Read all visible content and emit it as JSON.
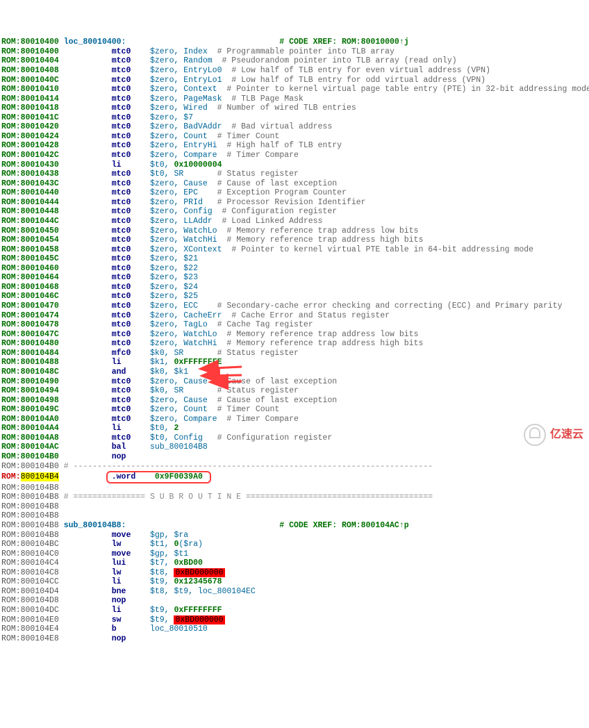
{
  "listing": [
    {
      "addr": "ROM:80010400",
      "style": "green",
      "loc": "loc_80010400:",
      "op": "",
      "args": "",
      "comment": "# CODE XREF: ROM:80010000↑j",
      "xref": true
    },
    {
      "addr": "ROM:80010400",
      "style": "green",
      "op": "mtc0",
      "reg": "$zero, Index",
      "comment": "# Programmable pointer into TLB array"
    },
    {
      "addr": "ROM:80010404",
      "style": "green",
      "op": "mtc0",
      "reg": "$zero, Random",
      "comment": "# Pseudorandom pointer into TLB array (read only)"
    },
    {
      "addr": "ROM:80010408",
      "style": "green",
      "op": "mtc0",
      "reg": "$zero, EntryLo0",
      "comment": "# Low half of TLB entry for even virtual address (VPN)"
    },
    {
      "addr": "ROM:8001040C",
      "style": "green",
      "op": "mtc0",
      "reg": "$zero, EntryLo1",
      "comment": "# Low half of TLB entry for odd virtual address (VPN)"
    },
    {
      "addr": "ROM:80010410",
      "style": "green",
      "op": "mtc0",
      "reg": "$zero, Context",
      "comment": "# Pointer to kernel virtual page table entry (PTE) in 32-bit addressing mode"
    },
    {
      "addr": "ROM:80010414",
      "style": "green",
      "op": "mtc0",
      "reg": "$zero, PageMask",
      "comment": "# TLB Page Mask"
    },
    {
      "addr": "ROM:80010418",
      "style": "green",
      "op": "mtc0",
      "reg": "$zero, Wired",
      "comment": "# Number of wired TLB entries"
    },
    {
      "addr": "ROM:8001041C",
      "style": "green",
      "op": "mtc0",
      "reg": "$zero, $7"
    },
    {
      "addr": "ROM:80010420",
      "style": "green",
      "op": "mtc0",
      "reg": "$zero, BadVAddr",
      "comment": "# Bad virtual address"
    },
    {
      "addr": "ROM:80010424",
      "style": "green",
      "op": "mtc0",
      "reg": "$zero, Count",
      "comment": "# Timer Count"
    },
    {
      "addr": "ROM:80010428",
      "style": "green",
      "op": "mtc0",
      "reg": "$zero, EntryHi",
      "comment": "# High half of TLB entry"
    },
    {
      "addr": "ROM:8001042C",
      "style": "green",
      "op": "mtc0",
      "reg": "$zero, Compare",
      "comment": "# Timer Compare"
    },
    {
      "addr": "ROM:80010430",
      "style": "green",
      "op": "li",
      "reg": "$t0,",
      "num": "0x10000004"
    },
    {
      "addr": "ROM:80010438",
      "style": "green",
      "op": "mtc0",
      "reg": "$t0, SR",
      "comment": "# Status register"
    },
    {
      "addr": "ROM:8001043C",
      "style": "green",
      "op": "mtc0",
      "reg": "$zero, Cause",
      "comment": "# Cause of last exception"
    },
    {
      "addr": "ROM:80010440",
      "style": "green",
      "op": "mtc0",
      "reg": "$zero, EPC",
      "comment": "# Exception Program Counter"
    },
    {
      "addr": "ROM:80010444",
      "style": "green",
      "op": "mtc0",
      "reg": "$zero, PRId",
      "comment": "# Processor Revision Identifier"
    },
    {
      "addr": "ROM:80010448",
      "style": "green",
      "op": "mtc0",
      "reg": "$zero, Config",
      "comment": "# Configuration register"
    },
    {
      "addr": "ROM:8001044C",
      "style": "green",
      "op": "mtc0",
      "reg": "$zero, LLAddr",
      "comment": "# Load Linked Address"
    },
    {
      "addr": "ROM:80010450",
      "style": "green",
      "op": "mtc0",
      "reg": "$zero, WatchLo",
      "comment": "# Memory reference trap address low bits"
    },
    {
      "addr": "ROM:80010454",
      "style": "green",
      "op": "mtc0",
      "reg": "$zero, WatchHi",
      "comment": "# Memory reference trap address high bits"
    },
    {
      "addr": "ROM:80010458",
      "style": "green",
      "op": "mtc0",
      "reg": "$zero, XContext",
      "comment": "# Pointer to kernel virtual PTE table in 64-bit addressing mode"
    },
    {
      "addr": "ROM:8001045C",
      "style": "green",
      "op": "mtc0",
      "reg": "$zero, $21"
    },
    {
      "addr": "ROM:80010460",
      "style": "green",
      "op": "mtc0",
      "reg": "$zero, $22"
    },
    {
      "addr": "ROM:80010464",
      "style": "green",
      "op": "mtc0",
      "reg": "$zero, $23"
    },
    {
      "addr": "ROM:80010468",
      "style": "green",
      "op": "mtc0",
      "reg": "$zero, $24"
    },
    {
      "addr": "ROM:8001046C",
      "style": "green",
      "op": "mtc0",
      "reg": "$zero, $25"
    },
    {
      "addr": "ROM:80010470",
      "style": "green",
      "op": "mtc0",
      "reg": "$zero, ECC",
      "comment": "# Secondary-cache error checking and correcting (ECC) and Primary parity"
    },
    {
      "addr": "ROM:80010474",
      "style": "green",
      "op": "mtc0",
      "reg": "$zero, CacheErr",
      "comment": "# Cache Error and Status register"
    },
    {
      "addr": "ROM:80010478",
      "style": "green",
      "op": "mtc0",
      "reg": "$zero, TagLo",
      "comment": "# Cache Tag register"
    },
    {
      "addr": "ROM:8001047C",
      "style": "green",
      "op": "mtc0",
      "reg": "$zero, WatchLo",
      "comment": "# Memory reference trap address low bits"
    },
    {
      "addr": "ROM:80010480",
      "style": "green",
      "op": "mtc0",
      "reg": "$zero, WatchHi",
      "comment": "# Memory reference trap address high bits"
    },
    {
      "addr": "ROM:80010484",
      "style": "green",
      "op": "mfc0",
      "reg": "$k0, SR",
      "comment": "# Status register"
    },
    {
      "addr": "ROM:80010488",
      "style": "green",
      "op": "li",
      "reg": "$k1,",
      "num": "0xFFFFFFFE"
    },
    {
      "addr": "ROM:8001048C",
      "style": "green",
      "op": "and",
      "reg": "$k0, $k1"
    },
    {
      "addr": "ROM:80010490",
      "style": "green",
      "op": "mtc0",
      "reg": "$zero, Cause",
      "comment": "# Cause of last exception"
    },
    {
      "addr": "ROM:80010494",
      "style": "green",
      "op": "mtc0",
      "reg": "$k0, SR",
      "comment": "# Status register"
    },
    {
      "addr": "ROM:80010498",
      "style": "green",
      "op": "mtc0",
      "reg": "$zero, Cause",
      "comment": "# Cause of last exception"
    },
    {
      "addr": "ROM:8001049C",
      "style": "green",
      "op": "mtc0",
      "reg": "$zero, Count",
      "comment": "# Timer Count"
    },
    {
      "addr": "ROM:800104A0",
      "style": "green",
      "op": "mtc0",
      "reg": "$zero, Compare",
      "comment": "# Timer Compare"
    },
    {
      "addr": "ROM:800104A4",
      "style": "green",
      "op": "li",
      "reg": "$t0,",
      "num": "2"
    },
    {
      "addr": "ROM:800104A8",
      "style": "green",
      "op": "mtc0",
      "reg": "$t0, Config",
      "comment": "# Configuration register"
    },
    {
      "addr": "ROM:800104AC",
      "style": "green",
      "op": "bal",
      "reg": "sub_800104B8"
    },
    {
      "addr": "ROM:800104B0",
      "style": "green",
      "op": "nop"
    },
    {
      "addr": "ROM:800104B0",
      "style": "norm",
      "sep": "# ---------------------------------------------------------------------------"
    },
    {
      "addr": "ROM:",
      "offset": "800104B4",
      "style": "active",
      "wordbox": true,
      "op": ".word",
      "num": "0x9F0039A0"
    },
    {
      "addr": "ROM:800104B8",
      "style": "norm"
    },
    {
      "addr": "ROM:800104B8",
      "style": "norm",
      "sep": "# =============== S U B R O U T I N E ======================================="
    },
    {
      "addr": "ROM:800104B8",
      "style": "norm"
    },
    {
      "addr": "ROM:800104B8",
      "style": "norm"
    },
    {
      "addr": "ROM:800104B8",
      "style": "norm",
      "loc": "sub_800104B8:",
      "comment": "# CODE XREF: ROM:800104AC↑p",
      "xref": true
    },
    {
      "addr": "ROM:800104B8",
      "style": "norm",
      "op": "move",
      "reg": "$gp, $ra"
    },
    {
      "addr": "ROM:800104BC",
      "style": "norm",
      "op": "lw",
      "reg": "$t1,",
      "num": "0",
      "reg2": "($ra)"
    },
    {
      "addr": "ROM:800104C0",
      "style": "norm",
      "op": "move",
      "reg": "$gp, $t1"
    },
    {
      "addr": "ROM:800104C4",
      "style": "norm",
      "op": "lui",
      "reg": "$t7,",
      "num": "0xBD00"
    },
    {
      "addr": "ROM:800104C8",
      "style": "norm",
      "op": "lw",
      "reg": "$t8,",
      "redhl": "0xBD000000"
    },
    {
      "addr": "ROM:800104CC",
      "style": "norm",
      "op": "li",
      "reg": "$t9,",
      "num": "0x12345678"
    },
    {
      "addr": "ROM:800104D4",
      "style": "norm",
      "op": "bne",
      "reg": "$t8, $t9, loc_800104EC"
    },
    {
      "addr": "ROM:800104D8",
      "style": "norm",
      "op": "nop"
    },
    {
      "addr": "ROM:800104DC",
      "style": "norm",
      "op": "li",
      "reg": "$t9,",
      "num": "0xFFFFFFFF"
    },
    {
      "addr": "ROM:800104E0",
      "style": "norm",
      "op": "sw",
      "reg": "$t9,",
      "redhl": "0xBD000000"
    },
    {
      "addr": "ROM:800104E4",
      "style": "norm",
      "op": "b",
      "reg": "loc_80010510"
    },
    {
      "addr": "ROM:800104E8",
      "style": "norm",
      "op": "nop"
    }
  ],
  "watermark": "亿速云"
}
